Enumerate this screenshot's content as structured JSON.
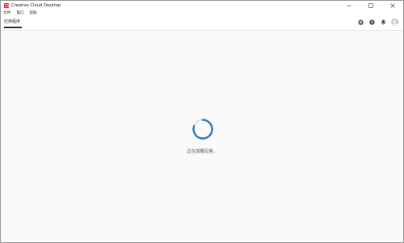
{
  "window": {
    "title": "Creative Cloud Desktop",
    "icon": "creative-cloud-icon",
    "controls": [
      "minimize-icon",
      "maximize-icon",
      "close-icon"
    ]
  },
  "menu": {
    "items": [
      {
        "label": "文件"
      },
      {
        "label": "窗口"
      },
      {
        "label": "帮助"
      }
    ]
  },
  "header": {
    "tab_label": "应用程序",
    "icons": [
      "gear-icon",
      "help-icon",
      "bell-icon",
      "avatar-icon"
    ]
  },
  "content": {
    "loading_text": "正在加载应用..."
  },
  "colors": {
    "brand": "#da1f26",
    "spinner": "#2b7bc0",
    "spinner_track": "#e2e2e2"
  }
}
